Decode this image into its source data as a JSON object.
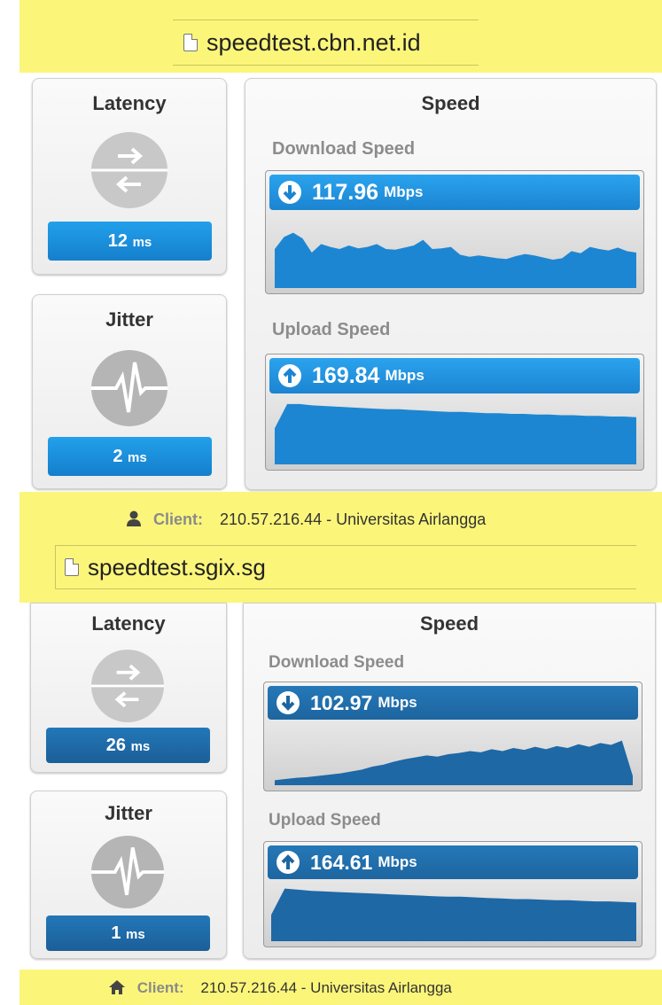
{
  "colors": {
    "blue_top": "#1e8fd6",
    "blue_bottom": "#1f6fae",
    "highlight": "#fbf67a"
  },
  "panels": [
    {
      "url": "speedtest.cbn.net.id",
      "latency": {
        "title": "Latency",
        "value": "12",
        "unit": "ms",
        "icon": "arrows-icon"
      },
      "jitter": {
        "title": "Jitter",
        "value": "2",
        "unit": "ms",
        "icon": "pulse-icon"
      },
      "speed": {
        "title": "Speed",
        "download": {
          "label": "Download Speed",
          "value": "117.96",
          "unit": "Mbps",
          "graph": [
            0.55,
            0.72,
            0.78,
            0.7,
            0.5,
            0.62,
            0.58,
            0.55,
            0.6,
            0.56,
            0.58,
            0.62,
            0.55,
            0.54,
            0.57,
            0.6,
            0.68,
            0.55,
            0.56,
            0.58,
            0.47,
            0.44,
            0.46,
            0.44,
            0.42,
            0.41,
            0.45,
            0.48,
            0.46,
            0.43,
            0.4,
            0.42,
            0.52,
            0.49,
            0.58,
            0.55,
            0.53,
            0.57,
            0.52,
            0.5
          ]
        },
        "upload": {
          "label": "Upload Speed",
          "value": "169.84",
          "unit": "Mbps",
          "graph": [
            0.55,
            0.92,
            0.92,
            0.9,
            0.89,
            0.88,
            0.87,
            0.86,
            0.85,
            0.84,
            0.84,
            0.83,
            0.82,
            0.81,
            0.8,
            0.8,
            0.79,
            0.78,
            0.78,
            0.77,
            0.77,
            0.76,
            0.76,
            0.75,
            0.75,
            0.74,
            0.74,
            0.73,
            0.73,
            0.72
          ]
        }
      },
      "client": {
        "label": "Client:",
        "text": "210.57.216.44 - Universitas Airlangga",
        "icon": "user-icon"
      }
    },
    {
      "url": "speedtest.sgix.sg",
      "latency": {
        "title": "Latency",
        "value": "26",
        "unit": "ms",
        "icon": "arrows-icon"
      },
      "jitter": {
        "title": "Jitter",
        "value": "1",
        "unit": "ms",
        "icon": "pulse-icon"
      },
      "speed": {
        "title": "Speed",
        "download": {
          "label": "Download Speed",
          "value": "102.97",
          "unit": "Mbps",
          "graph": [
            0.08,
            0.1,
            0.12,
            0.13,
            0.15,
            0.17,
            0.19,
            0.22,
            0.25,
            0.3,
            0.33,
            0.38,
            0.42,
            0.45,
            0.48,
            0.46,
            0.5,
            0.52,
            0.55,
            0.53,
            0.58,
            0.55,
            0.6,
            0.57,
            0.62,
            0.58,
            0.63,
            0.6,
            0.66,
            0.62,
            0.68,
            0.65,
            0.72,
            0.15
          ]
        },
        "upload": {
          "label": "Upload Speed",
          "value": "164.61",
          "unit": "Mbps",
          "graph": [
            0.45,
            0.9,
            0.88,
            0.86,
            0.85,
            0.84,
            0.83,
            0.82,
            0.81,
            0.8,
            0.79,
            0.78,
            0.77,
            0.76,
            0.76,
            0.75,
            0.74,
            0.73,
            0.72,
            0.72,
            0.71,
            0.7,
            0.7,
            0.69,
            0.68,
            0.68,
            0.67,
            0.66
          ]
        }
      },
      "client": {
        "label": "Client:",
        "text": "210.57.216.44 - Universitas Airlangga",
        "icon": "home-icon"
      }
    }
  ]
}
